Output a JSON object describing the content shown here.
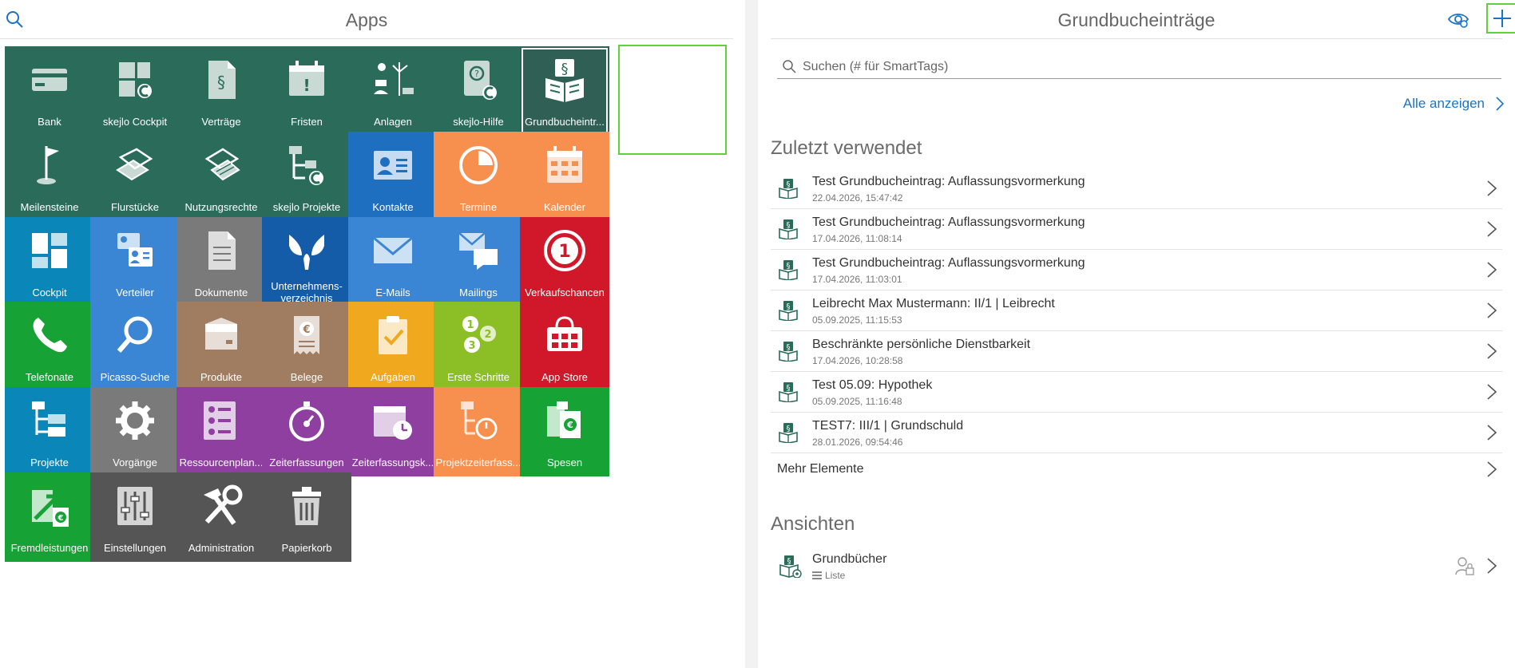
{
  "left_panel": {
    "title": "Apps"
  },
  "right_panel": {
    "title": "Grundbucheinträge",
    "search_placeholder": "Suchen (# für SmartTags)",
    "show_all_label": "Alle anzeigen",
    "recent_title": "Zuletzt verwendet",
    "recent_items": [
      {
        "title": "Test Grundbucheintrag: Auflassungsvormerkung",
        "date": "22.04.2026, 15:47:42"
      },
      {
        "title": "Test Grundbucheintrag: Auflassungsvormerkung",
        "date": "17.04.2026, 11:08:14"
      },
      {
        "title": "Test Grundbucheintrag: Auflassungsvormerkung",
        "date": "17.04.2026, 11:03:01"
      },
      {
        "title": "Leibrecht Max Mustermann: II/1 | Leibrecht",
        "date": "05.09.2025, 11:15:53"
      },
      {
        "title": "Beschränkte persönliche Dienstbarkeit",
        "date": "17.04.2026, 10:28:58"
      },
      {
        "title": "Test 05.09: Hypothek",
        "date": "05.09.2025, 11:16:48"
      },
      {
        "title": "TEST7: III/1 | Grundschuld",
        "date": "28.01.2026, 09:54:46"
      }
    ],
    "more_label": "Mehr Elemente",
    "views_title": "Ansichten",
    "views": [
      {
        "title": "Grundbücher",
        "subtitle": "Liste"
      }
    ]
  },
  "apps": [
    {
      "label": "Bank",
      "icon": "bank-card-icon",
      "color": "#2a6b5a"
    },
    {
      "label": "skejlo Cockpit",
      "icon": "cockpit-icon",
      "color": "#2a6b5a"
    },
    {
      "label": "Verträge",
      "icon": "contract-icon",
      "color": "#2a6b5a"
    },
    {
      "label": "Fristen",
      "icon": "deadline-icon",
      "color": "#2a6b5a"
    },
    {
      "label": "Anlagen",
      "icon": "plants-icon",
      "color": "#2a6b5a"
    },
    {
      "label": "skejlo-Hilfe",
      "icon": "help-book-icon",
      "color": "#2a6b5a"
    },
    {
      "label": "Grundbucheintr...",
      "icon": "land-register-icon",
      "color": "#2a6b5a"
    },
    {
      "label": "Meilensteine",
      "icon": "milestone-flag-icon",
      "color": "#2a6b5a"
    },
    {
      "label": "Flurstücke",
      "icon": "parcel-icon",
      "color": "#2a6b5a"
    },
    {
      "label": "Nutzungsrechte",
      "icon": "usage-rights-icon",
      "color": "#2a6b5a"
    },
    {
      "label": "skejlo Projekte",
      "icon": "project-tree-icon",
      "color": "#2a6b5a"
    },
    {
      "label": "Kontakte",
      "icon": "contact-card-icon",
      "color": "#1e6fc0"
    },
    {
      "label": "Termine",
      "icon": "appointment-icon",
      "color": "#f7904f"
    },
    {
      "label": "Kalender",
      "icon": "calendar-icon",
      "color": "#f7904f"
    },
    {
      "label": "Cockpit",
      "icon": "dashboard-icon",
      "color": "#0a87b8"
    },
    {
      "label": "Verteiler",
      "icon": "distribution-icon",
      "color": "#3a86d4"
    },
    {
      "label": "Dokumente",
      "icon": "document-icon",
      "color": "#7a7a7a"
    },
    {
      "label": "Unternehmens-verzeichnis",
      "icon": "company-directory-icon",
      "color": "#155ca8"
    },
    {
      "label": "E-Mails",
      "icon": "mail-icon",
      "color": "#3a86d4"
    },
    {
      "label": "Mailings",
      "icon": "mailing-icon",
      "color": "#3a86d4"
    },
    {
      "label": "Verkaufschancen",
      "icon": "sales-chance-icon",
      "color": "#d0182a"
    },
    {
      "label": "Telefonate",
      "icon": "phone-icon",
      "color": "#16a234"
    },
    {
      "label": "Picasso-Suche",
      "icon": "magnifier-icon",
      "color": "#3a86d4"
    },
    {
      "label": "Produkte",
      "icon": "product-box-icon",
      "color": "#a07c60"
    },
    {
      "label": "Belege",
      "icon": "receipt-icon",
      "color": "#a07c60"
    },
    {
      "label": "Aufgaben",
      "icon": "task-clipboard-icon",
      "color": "#f0a81e"
    },
    {
      "label": "Erste Schritte",
      "icon": "first-steps-icon",
      "color": "#8cbf26"
    },
    {
      "label": "App Store",
      "icon": "app-store-icon",
      "color": "#d0182a"
    },
    {
      "label": "Projekte",
      "icon": "projects-icon",
      "color": "#0a87b8"
    },
    {
      "label": "Vorgänge",
      "icon": "gear-icon",
      "color": "#7a7a7a"
    },
    {
      "label": "Ressourcenplan...",
      "icon": "resource-plan-icon",
      "color": "#8e3fa0"
    },
    {
      "label": "Zeiterfassungen",
      "icon": "stopwatch-icon",
      "color": "#8e3fa0"
    },
    {
      "label": "Zeiterfassungsk...",
      "icon": "time-calendar-icon",
      "color": "#8e3fa0"
    },
    {
      "label": "Projektzeiterfass...",
      "icon": "project-time-icon",
      "color": "#f7904f"
    },
    {
      "label": "Spesen",
      "icon": "expenses-icon",
      "color": "#16a234"
    },
    {
      "label": "Fremdleistungen",
      "icon": "external-services-icon",
      "color": "#16a234"
    },
    {
      "label": "Einstellungen",
      "icon": "settings-sliders-icon",
      "color": "#555555"
    },
    {
      "label": "Administration",
      "icon": "tools-icon",
      "color": "#555555"
    },
    {
      "label": "Papierkorb",
      "icon": "trash-icon",
      "color": "#555555"
    }
  ],
  "colors": {
    "accent": "#1a73c7",
    "selection": "#5fd13c"
  }
}
